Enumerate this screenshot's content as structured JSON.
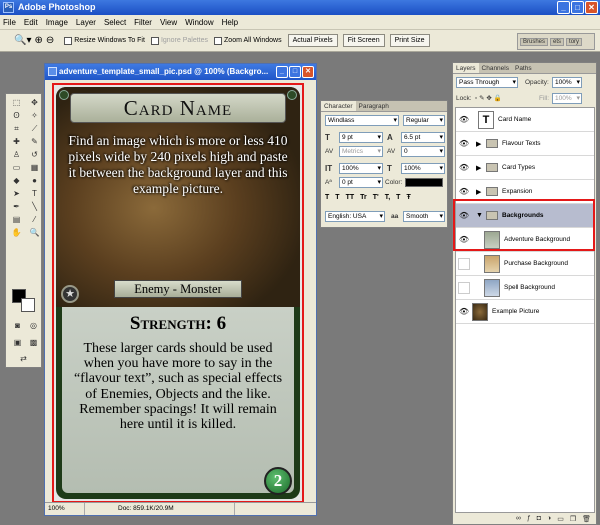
{
  "app": {
    "title": "Adobe Photoshop"
  },
  "menu": [
    "File",
    "Edit",
    "Image",
    "Layer",
    "Select",
    "Filter",
    "View",
    "Window",
    "Help"
  ],
  "options": {
    "resize_windows": "Resize Windows To Fit",
    "ignore_palettes": "Ignore Palettes",
    "zoom_all": "Zoom All Windows",
    "actual_pixels": "Actual Pixels",
    "fit_screen": "Fit Screen",
    "print_size": "Print Size",
    "well_tabs": [
      "Brushes",
      "ets",
      "tory"
    ]
  },
  "document": {
    "title": "adventure_template_small_pic.psd @ 100% (Backgro...",
    "zoom": "100%",
    "doc_info": "Doc: 859.1K/20.9M"
  },
  "card": {
    "name": "Card Name",
    "flavour": "Find an image which is more or less 410 pixels wide by 240 pixels high and paste it between the background layer and this example picture.",
    "type": "Enemy - Monster",
    "strength": "Strength: 6",
    "body": "These larger cards should be used when you have more to say in the “flavour text”, such as special effects of Enemies, Objects and the like. Remember spacings! It will remain here until it is killed.",
    "value": "2"
  },
  "character": {
    "tabs": [
      "Character",
      "Paragraph"
    ],
    "font": "Windlass",
    "style": "Regular",
    "size": "9 pt",
    "leading": "6.5 pt",
    "kerning": "Metrics",
    "tracking": "0",
    "vscale": "100%",
    "hscale": "100%",
    "baseline": "0 pt",
    "color_label": "Color:",
    "language": "English: USA",
    "aa_label": "aa",
    "aa": "Smooth",
    "faux": [
      "T",
      "T",
      "TT",
      "Tr",
      "T'",
      "T,",
      "T",
      "Ŧ"
    ]
  },
  "layers": {
    "tabs": [
      "Layers",
      "Channels",
      "Paths"
    ],
    "blend": "Pass Through",
    "opacity_label": "Opacity:",
    "opacity": "100%",
    "lock_label": "Lock:",
    "fill_label": "Fill:",
    "fill": "100%",
    "items": [
      {
        "name": "Card Name",
        "kind": "text"
      },
      {
        "name": "Flavour Texts",
        "kind": "folder"
      },
      {
        "name": "Card Types",
        "kind": "folder"
      },
      {
        "name": "Expansion",
        "kind": "folder"
      },
      {
        "name": "Backgrounds",
        "kind": "folder-open"
      },
      {
        "name": "Adventure Background",
        "kind": "image"
      },
      {
        "name": "Purchase Background",
        "kind": "image"
      },
      {
        "name": "Spell Background",
        "kind": "image"
      },
      {
        "name": "Example Picture",
        "kind": "image"
      }
    ]
  },
  "colors": {
    "highlight": "#e41818",
    "titlebar": "#1b4fc4"
  }
}
